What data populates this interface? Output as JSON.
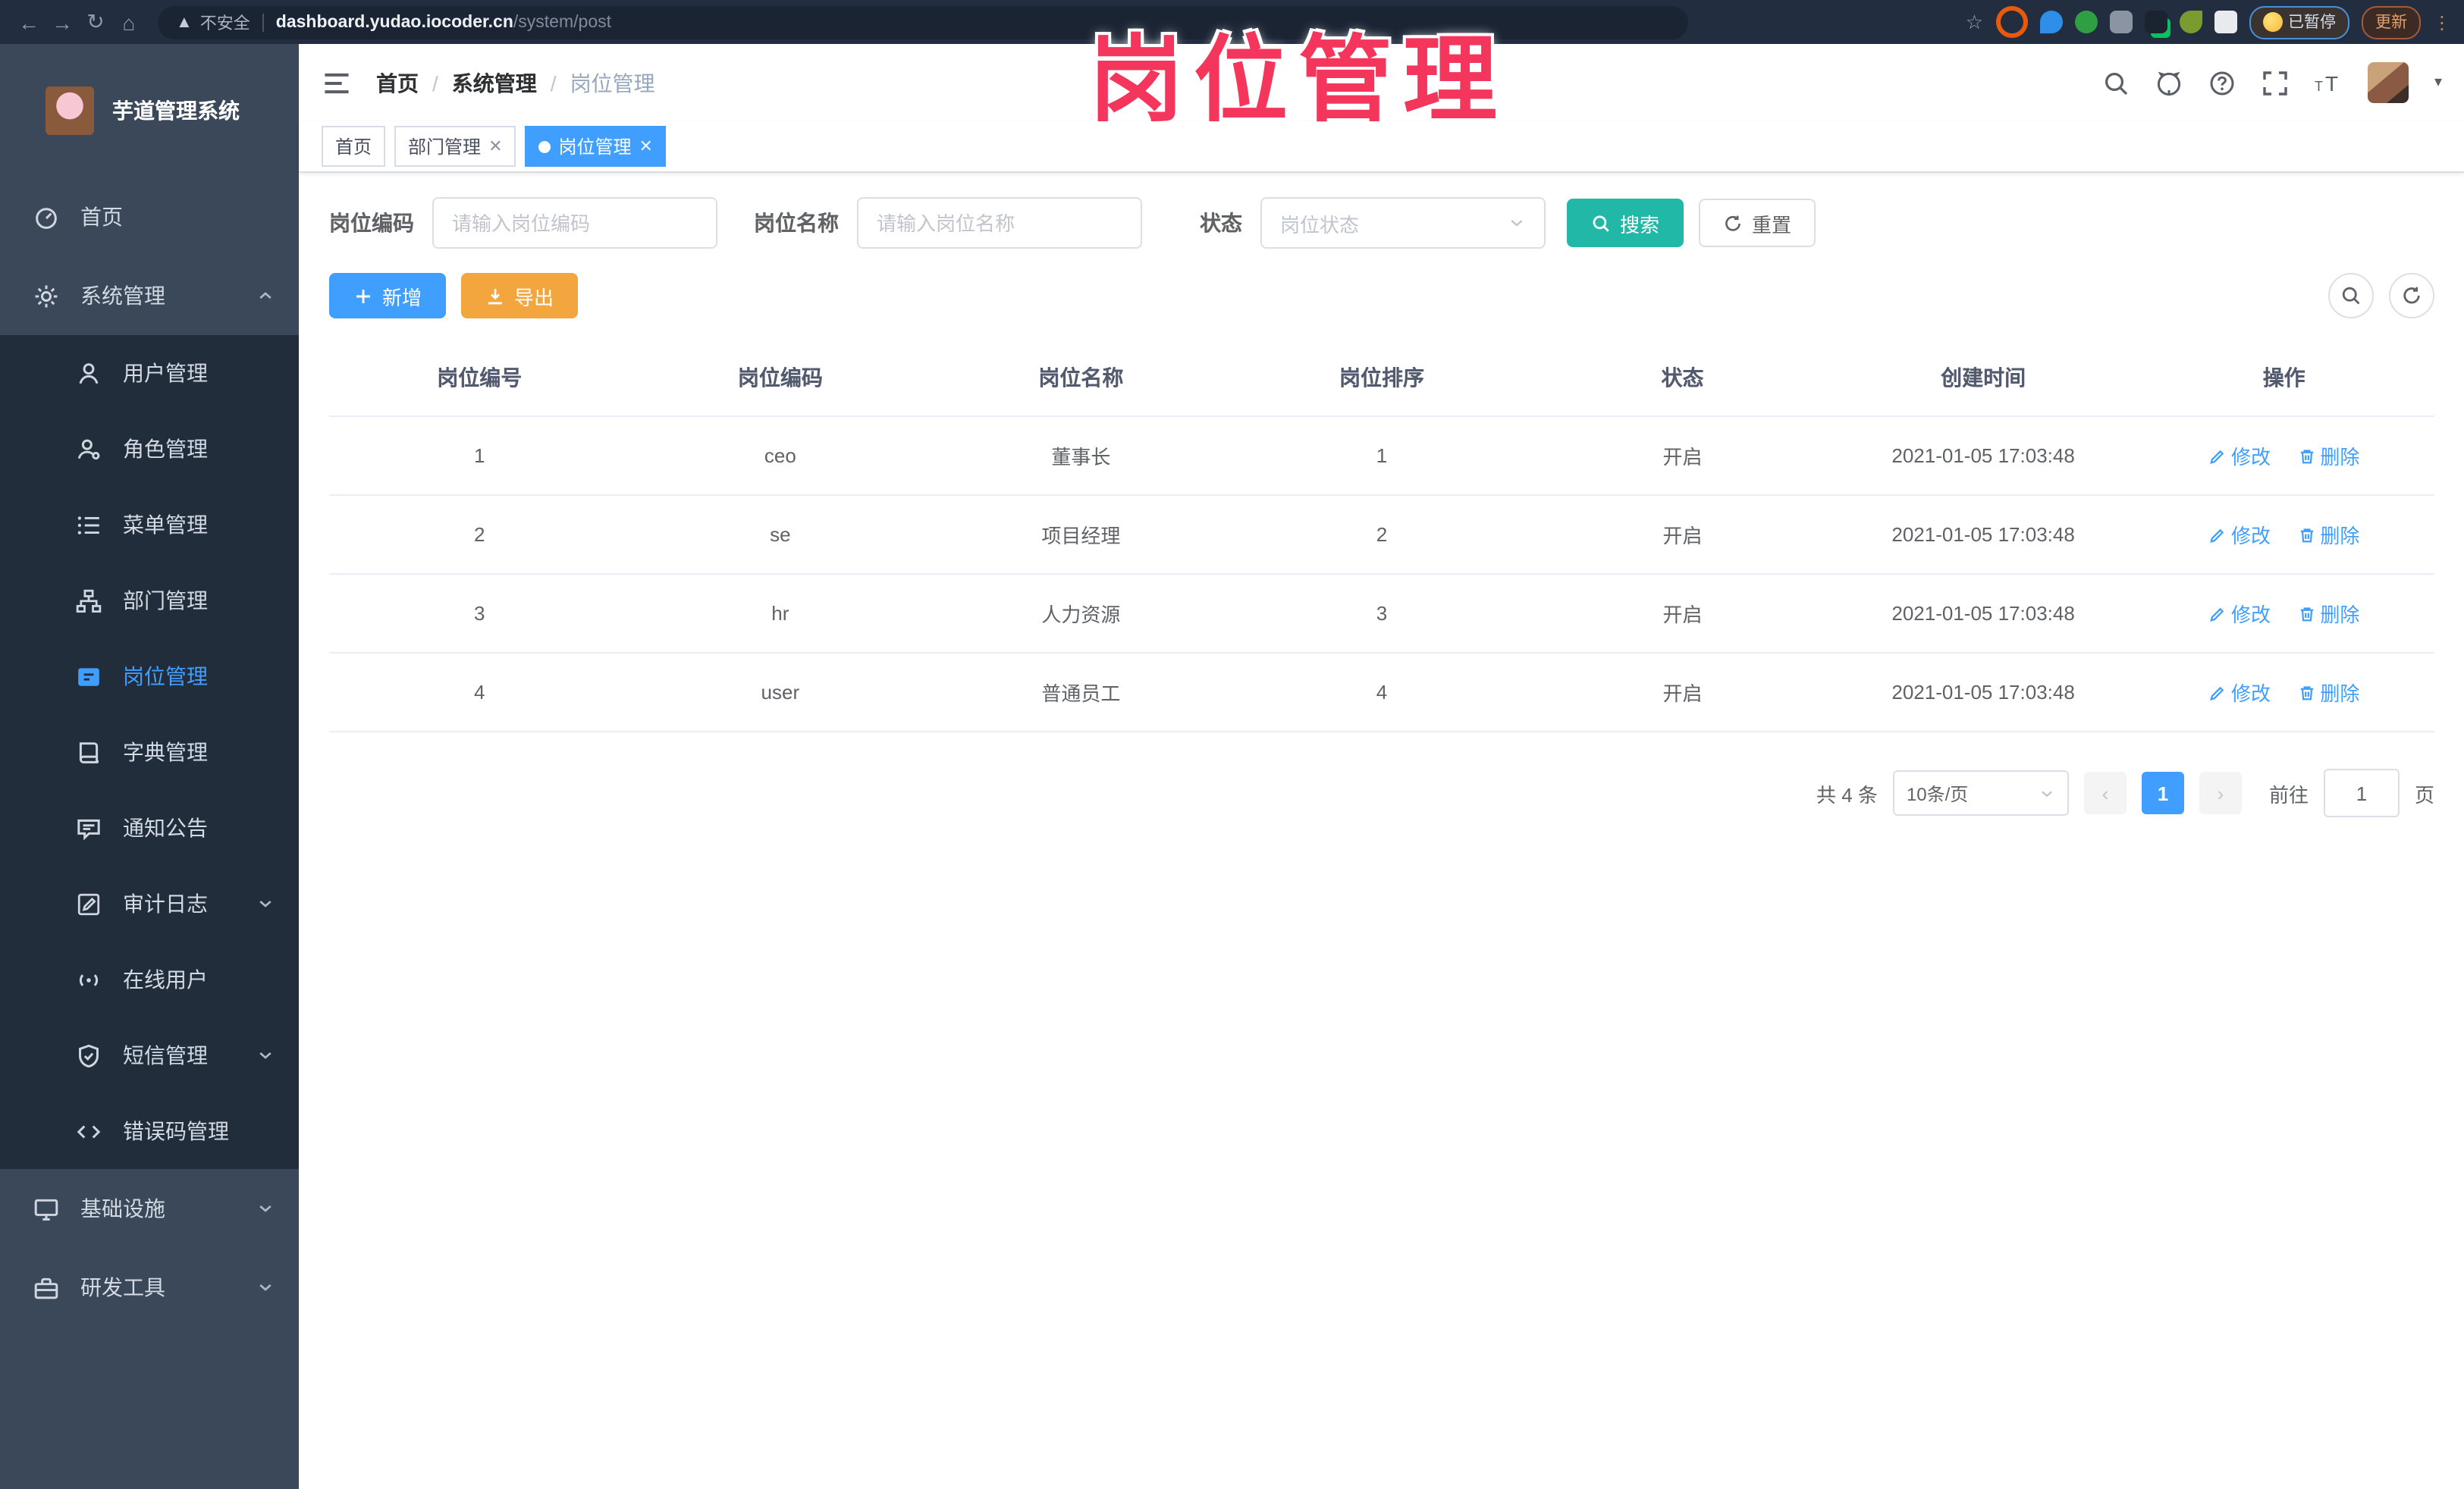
{
  "browser": {
    "security_label": "不安全",
    "url_host": "dashboard.yudao.iocoder.cn",
    "url_path": "/system/post",
    "paused_label": "已暂停",
    "update_label": "更新"
  },
  "watermark": "岗位管理",
  "sidebar": {
    "title": "芋道管理系统",
    "home_label": "首页",
    "system": {
      "label": "系统管理",
      "children": [
        "用户管理",
        "角色管理",
        "菜单管理",
        "部门管理",
        "岗位管理",
        "字典管理",
        "通知公告",
        "审计日志",
        "在线用户",
        "短信管理",
        "错误码管理"
      ]
    },
    "infra_label": "基础设施",
    "devtools_label": "研发工具"
  },
  "breadcrumb": [
    "首页",
    "系统管理",
    "岗位管理"
  ],
  "tabs": [
    {
      "label": "首页"
    },
    {
      "label": "部门管理"
    },
    {
      "label": "岗位管理"
    }
  ],
  "search": {
    "code_label": "岗位编码",
    "code_placeholder": "请输入岗位编码",
    "name_label": "岗位名称",
    "name_placeholder": "请输入岗位名称",
    "status_label": "状态",
    "status_placeholder": "岗位状态",
    "submit_label": "搜索",
    "reset_label": "重置"
  },
  "toolbar": {
    "add_label": "新增",
    "export_label": "导出"
  },
  "table": {
    "headers": [
      "岗位编号",
      "岗位编码",
      "岗位名称",
      "岗位排序",
      "状态",
      "创建时间",
      "操作"
    ],
    "edit_label": "修改",
    "delete_label": "删除",
    "rows": [
      {
        "id": "1",
        "code": "ceo",
        "name": "董事长",
        "sort": "1",
        "status": "开启",
        "time": "2021-01-05 17:03:48"
      },
      {
        "id": "2",
        "code": "se",
        "name": "项目经理",
        "sort": "2",
        "status": "开启",
        "time": "2021-01-05 17:03:48"
      },
      {
        "id": "3",
        "code": "hr",
        "name": "人力资源",
        "sort": "3",
        "status": "开启",
        "time": "2021-01-05 17:03:48"
      },
      {
        "id": "4",
        "code": "user",
        "name": "普通员工",
        "sort": "4",
        "status": "开启",
        "time": "2021-01-05 17:03:48"
      }
    ]
  },
  "pagination": {
    "total": "共 4 条",
    "per_page": "10条/页",
    "page": "1",
    "goto_prefix": "前往",
    "goto_value": "1",
    "goto_suffix": "页"
  },
  "colors": {
    "primary": "#409eff",
    "search_button": "#22b8a8",
    "export_button": "#f2a63d",
    "watermark": "#f5365c",
    "sidebar_bg": "#3a4859",
    "submenu_bg": "#222d3b",
    "browser_bar_bg": "#222d3f"
  }
}
